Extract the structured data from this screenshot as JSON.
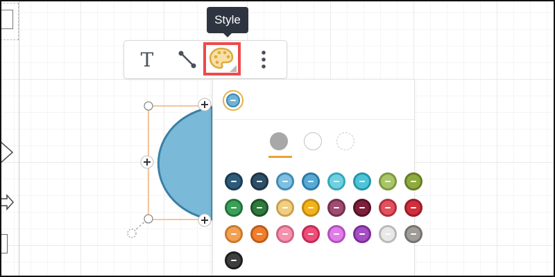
{
  "toolbar": {
    "text_tool_glyph": "T",
    "line_tool_icon": "connector-line-icon",
    "style_tool_icon": "palette-icon",
    "more_tool_icon": "vertical-ellipsis-icon",
    "highlight_color": "#ef4a4a"
  },
  "tooltip": {
    "label": "Style"
  },
  "shape": {
    "fill_color": "#7ab9d8",
    "stroke_color": "#3a7fa6",
    "selection_color": "#f0b27a",
    "handle_icon": "plus-handle-icon"
  },
  "style_panel": {
    "current_color": "#6fb3d6",
    "fill_options": [
      "solid-fill-icon",
      "no-fill-icon",
      "dashed-fill-icon"
    ],
    "selected_fill_indicator_color": "#e8a431",
    "swatches": [
      {
        "fill": "#2f5b7a",
        "stroke": "#1b3c54"
      },
      {
        "fill": "#2e4f66",
        "stroke": "#1c3447"
      },
      {
        "fill": "#7fbfe0",
        "stroke": "#3f8cb5"
      },
      {
        "fill": "#58a9d6",
        "stroke": "#2c7aa8"
      },
      {
        "fill": "#6fd0e0",
        "stroke": "#36a7b8"
      },
      {
        "fill": "#4fc4d8",
        "stroke": "#2496aa"
      },
      {
        "fill": "#a9c56a",
        "stroke": "#7b9a3e"
      },
      {
        "fill": "#8faa3f",
        "stroke": "#677e25"
      },
      {
        "fill": "#3aa058",
        "stroke": "#23713a"
      },
      {
        "fill": "#2f7a3c",
        "stroke": "#1d5126"
      },
      {
        "fill": "#f0cf84",
        "stroke": "#c9a24d"
      },
      {
        "fill": "#f2b21d",
        "stroke": "#c38a0d"
      },
      {
        "fill": "#a04b72",
        "stroke": "#72304f"
      },
      {
        "fill": "#7e1f3c",
        "stroke": "#541228"
      },
      {
        "fill": "#e0525e",
        "stroke": "#b12f3b"
      },
      {
        "fill": "#cf2f3c",
        "stroke": "#9a1c27"
      },
      {
        "fill": "#f2a154",
        "stroke": "#c97a2c"
      },
      {
        "fill": "#ef7f2e",
        "stroke": "#c05c17"
      },
      {
        "fill": "#f592ad",
        "stroke": "#cd6583"
      },
      {
        "fill": "#ee4e78",
        "stroke": "#c22b54"
      },
      {
        "fill": "#e07ee8",
        "stroke": "#b24fbc"
      },
      {
        "fill": "#a64fc4",
        "stroke": "#7a2e97"
      },
      {
        "fill": "#e8e8e8",
        "stroke": "#b9b9b9"
      },
      {
        "fill": "#a09c98",
        "stroke": "#76726e"
      },
      {
        "fill": "#3e3e3e",
        "stroke": "#1d1d1d"
      }
    ]
  }
}
